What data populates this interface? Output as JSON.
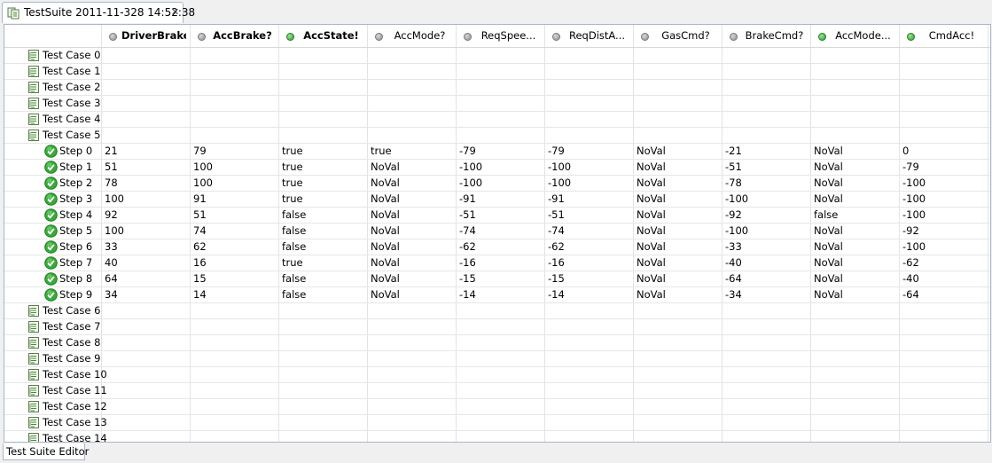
{
  "tab": {
    "title": "TestSuite 2011-11-328 14:52:38",
    "icon": "test-suite-icon",
    "close_icon": "close-icon"
  },
  "columns": [
    {
      "label": "DriverBrake?",
      "status": "gray",
      "bold": true
    },
    {
      "label": "AccBrake?",
      "status": "gray",
      "bold": true
    },
    {
      "label": "AccState!",
      "status": "green",
      "bold": true
    },
    {
      "label": "AccMode?",
      "status": "gray",
      "bold": false
    },
    {
      "label": "ReqSpee...",
      "status": "gray",
      "bold": false
    },
    {
      "label": "ReqDistA...",
      "status": "gray",
      "bold": false
    },
    {
      "label": "GasCmd?",
      "status": "gray",
      "bold": false
    },
    {
      "label": "BrakeCmd?",
      "status": "gray",
      "bold": false
    },
    {
      "label": "AccMode...",
      "status": "green",
      "bold": false
    },
    {
      "label": "CmdAcc!",
      "status": "green",
      "bold": false
    }
  ],
  "status_colors": {
    "green": "#2e9a2e",
    "gray": "#8c8c8c"
  },
  "rows": [
    {
      "type": "case",
      "name": "Test Case 0"
    },
    {
      "type": "case",
      "name": "Test Case 1"
    },
    {
      "type": "case",
      "name": "Test Case 2"
    },
    {
      "type": "case",
      "name": "Test Case 3"
    },
    {
      "type": "case",
      "name": "Test Case 4"
    },
    {
      "type": "case",
      "name": "Test Case 5"
    },
    {
      "type": "step",
      "name": "Step 0",
      "values": [
        "21",
        "79",
        "true",
        "true",
        "-79",
        "-79",
        "NoVal",
        "-21",
        "NoVal",
        "0"
      ]
    },
    {
      "type": "step",
      "name": "Step 1",
      "values": [
        "51",
        "100",
        "true",
        "NoVal",
        "-100",
        "-100",
        "NoVal",
        "-51",
        "NoVal",
        "-79"
      ]
    },
    {
      "type": "step",
      "name": "Step 2",
      "values": [
        "78",
        "100",
        "true",
        "NoVal",
        "-100",
        "-100",
        "NoVal",
        "-78",
        "NoVal",
        "-100"
      ]
    },
    {
      "type": "step",
      "name": "Step 3",
      "values": [
        "100",
        "91",
        "true",
        "NoVal",
        "-91",
        "-91",
        "NoVal",
        "-100",
        "NoVal",
        "-100"
      ]
    },
    {
      "type": "step",
      "name": "Step 4",
      "values": [
        "92",
        "51",
        "false",
        "NoVal",
        "-51",
        "-51",
        "NoVal",
        "-92",
        "false",
        "-100"
      ]
    },
    {
      "type": "step",
      "name": "Step 5",
      "values": [
        "100",
        "74",
        "false",
        "NoVal",
        "-74",
        "-74",
        "NoVal",
        "-100",
        "NoVal",
        "-92"
      ]
    },
    {
      "type": "step",
      "name": "Step 6",
      "values": [
        "33",
        "62",
        "false",
        "NoVal",
        "-62",
        "-62",
        "NoVal",
        "-33",
        "NoVal",
        "-100"
      ]
    },
    {
      "type": "step",
      "name": "Step 7",
      "values": [
        "40",
        "16",
        "true",
        "NoVal",
        "-16",
        "-16",
        "NoVal",
        "-40",
        "NoVal",
        "-62"
      ]
    },
    {
      "type": "step",
      "name": "Step 8",
      "values": [
        "64",
        "15",
        "false",
        "NoVal",
        "-15",
        "-15",
        "NoVal",
        "-64",
        "NoVal",
        "-40"
      ]
    },
    {
      "type": "step",
      "name": "Step 9",
      "values": [
        "34",
        "14",
        "false",
        "NoVal",
        "-14",
        "-14",
        "NoVal",
        "-34",
        "NoVal",
        "-64"
      ]
    },
    {
      "type": "case",
      "name": "Test Case 6"
    },
    {
      "type": "case",
      "name": "Test Case 7"
    },
    {
      "type": "case",
      "name": "Test Case 8"
    },
    {
      "type": "case",
      "name": "Test Case 9"
    },
    {
      "type": "case",
      "name": "Test Case 10"
    },
    {
      "type": "case",
      "name": "Test Case 11"
    },
    {
      "type": "case",
      "name": "Test Case 12"
    },
    {
      "type": "case",
      "name": "Test Case 13"
    },
    {
      "type": "case",
      "name": "Test Case 14"
    }
  ],
  "bottom_tab": {
    "label": "Test Suite Editor"
  }
}
